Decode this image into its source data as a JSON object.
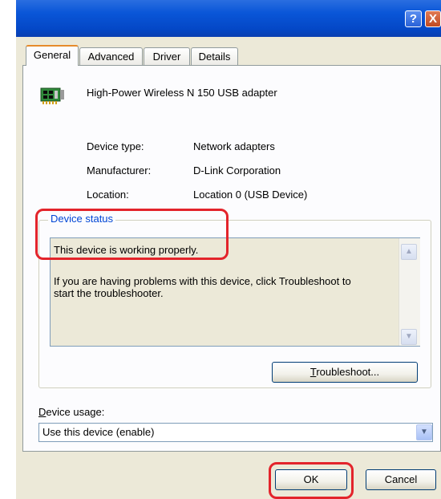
{
  "window": {
    "help_label": "?",
    "close_label": "X"
  },
  "tabs": [
    {
      "label": "General",
      "active": true
    },
    {
      "label": "Advanced",
      "active": false
    },
    {
      "label": "Driver",
      "active": false
    },
    {
      "label": "Details",
      "active": false
    }
  ],
  "device": {
    "name": "High-Power Wireless N 150 USB adapter",
    "icon": "network-adapter-icon",
    "properties": [
      {
        "label": "Device type:",
        "value": "Network adapters"
      },
      {
        "label": "Manufacturer:",
        "value": "D-Link Corporation"
      },
      {
        "label": "Location:",
        "value": "Location 0 (USB Device)"
      }
    ]
  },
  "status": {
    "group_title": "Device status",
    "line1": "This device is working properly.",
    "line2": "If you are having problems with this device, click Troubleshoot to",
    "line3": "start the troubleshooter.",
    "troubleshoot_prefix": "",
    "troubleshoot_hotkey": "T",
    "troubleshoot_rest": "roubleshoot..."
  },
  "usage": {
    "label_hotkey": "D",
    "label_rest": "evice usage:",
    "selected": "Use this device (enable)"
  },
  "footer": {
    "ok_label": "OK",
    "cancel_label": "Cancel"
  },
  "colors": {
    "highlight": "#e3242b",
    "titlebar": "#0a56d8",
    "group_title": "#0046d5"
  }
}
